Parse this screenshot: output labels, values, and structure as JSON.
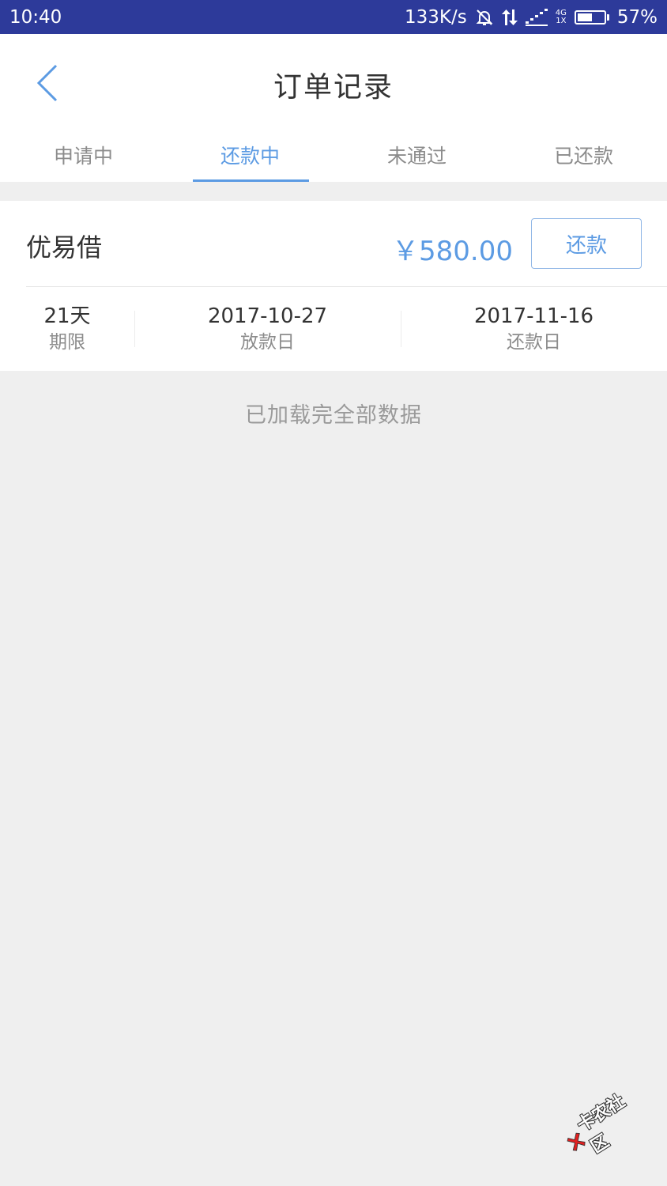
{
  "status_bar": {
    "time": "10:40",
    "net_speed": "133K/s",
    "net_type_top": "4G",
    "net_type_bottom": "1X",
    "battery": "57%",
    "battery_level": 0.57
  },
  "header": {
    "title": "订单记录"
  },
  "tabs": [
    {
      "label": "申请中",
      "active": false
    },
    {
      "label": "还款中",
      "active": true
    },
    {
      "label": "未通过",
      "active": false
    },
    {
      "label": "已还款",
      "active": false
    }
  ],
  "order": {
    "lender": "优易借",
    "amount": "￥580.00",
    "repay_label": "还款",
    "term_value": "21天",
    "term_label": "期限",
    "loan_date": "2017-10-27",
    "loan_date_label": "放款日",
    "due_date": "2017-11-16",
    "due_date_label": "还款日"
  },
  "list_end_text": "已加载完全部数据",
  "watermark": {
    "text": "卡农社区"
  },
  "colors": {
    "status_bar_bg": "#2d3a9a",
    "accent": "#5c9be3",
    "page_bg": "#efefef"
  }
}
